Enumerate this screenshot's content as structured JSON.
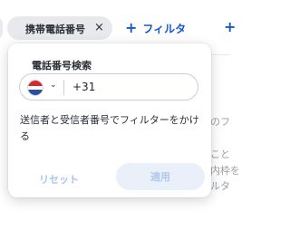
{
  "filter_bar": {
    "chip_label": "携帯電話番号",
    "chip_close": "×",
    "add_filter_label": "フィルタ",
    "add_icon": "+"
  },
  "background": {
    "text_1": "のフ",
    "text_2": "こと",
    "text_3": "内枠を",
    "text_4": "ルタ"
  },
  "popover": {
    "title": "電話番号検索",
    "phone_input": {
      "country_flag": "netherlands-flag-icon",
      "value": "+31"
    },
    "description": "送信者と受信者番号でフィルターをかける",
    "reset_label": "リセット",
    "apply_label": "適用"
  }
}
